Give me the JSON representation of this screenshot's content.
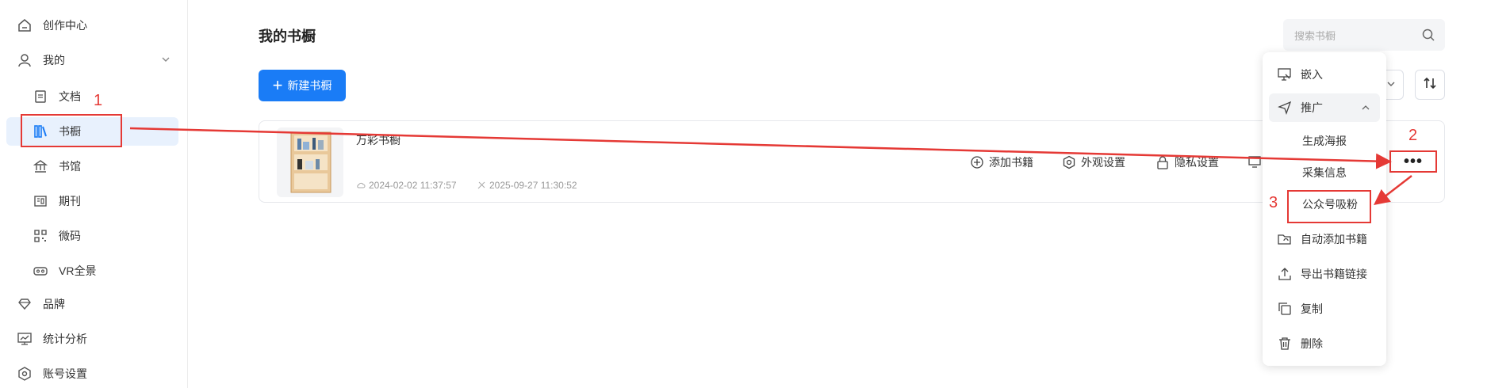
{
  "sidebar": {
    "items": [
      {
        "label": "创作中心",
        "icon": "home-icon"
      },
      {
        "label": "我的",
        "icon": "user-icon"
      },
      {
        "label": "文档",
        "icon": "document-icon"
      },
      {
        "label": "书橱",
        "icon": "bookcase-icon"
      },
      {
        "label": "书馆",
        "icon": "library-icon"
      },
      {
        "label": "期刊",
        "icon": "journal-icon"
      },
      {
        "label": "微码",
        "icon": "qrcode-icon"
      },
      {
        "label": "VR全景",
        "icon": "vr-icon"
      },
      {
        "label": "品牌",
        "icon": "diamond-icon"
      },
      {
        "label": "统计分析",
        "icon": "chart-icon"
      },
      {
        "label": "账号设置",
        "icon": "gear-icon"
      }
    ]
  },
  "main": {
    "page_title": "我的书橱",
    "search_placeholder": "搜索书橱",
    "new_button_label": "新建书橱",
    "card": {
      "name": "万彩书橱",
      "created": "2024-02-02 11:37:57",
      "updated": "2025-09-27 11:30:52",
      "actions": [
        "添加书籍",
        "外观设置",
        "隐私设置"
      ]
    }
  },
  "menu": {
    "items": [
      "嵌入",
      "推广",
      "生成海报",
      "采集信息",
      "公众号吸粉",
      "自动添加书籍",
      "导出书籍链接",
      "复制",
      "删除"
    ]
  },
  "annotations": [
    "1",
    "2",
    "3"
  ],
  "colors": {
    "accent": "#1a7cf6",
    "annotation": "#e53935",
    "active_bg": "#e8f1fd"
  }
}
